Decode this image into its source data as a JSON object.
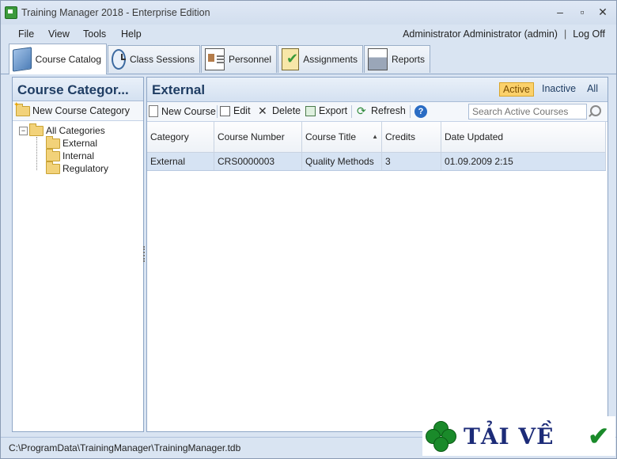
{
  "window": {
    "title": "Training Manager 2018 - Enterprise Edition",
    "minimize": "–",
    "maximize": "▫",
    "close": "✕"
  },
  "menu": {
    "items": [
      "File",
      "View",
      "Tools",
      "Help"
    ]
  },
  "user": {
    "name": "Administrator Administrator (admin)",
    "separator": "|",
    "logoff": "Log Off"
  },
  "tabs": [
    {
      "label": "Course Catalog",
      "icon": "book-icon",
      "active": true
    },
    {
      "label": "Class Sessions",
      "icon": "clock-icon",
      "active": false
    },
    {
      "label": "Personnel",
      "icon": "id-card-icon",
      "active": false
    },
    {
      "label": "Assignments",
      "icon": "clipboard-check-icon",
      "active": false
    },
    {
      "label": "Reports",
      "icon": "printer-icon",
      "active": false
    }
  ],
  "left": {
    "title": "Course Categor...",
    "new_category": "New Course Category",
    "tree": {
      "root": "All Categories",
      "expander": "−",
      "children": [
        "External",
        "Internal",
        "Regulatory"
      ]
    }
  },
  "right": {
    "title": "External",
    "filters": {
      "active": "Active",
      "inactive": "Inactive",
      "all": "All"
    },
    "toolbar": {
      "new": "New Course",
      "edit": "Edit",
      "delete": "Delete",
      "export": "Export",
      "refresh": "Refresh",
      "help": "?"
    },
    "search_placeholder": "Search Active Courses",
    "columns": [
      "Category",
      "Course Number",
      "Course Title",
      "Credits",
      "Date Updated"
    ],
    "sort_indicator": "▲",
    "rows": [
      [
        "External",
        "CRS0000003",
        "Quality Methods",
        "3",
        "01.09.2009 2:15"
      ]
    ]
  },
  "status": {
    "path": "C:\\ProgramData\\TrainingManager\\TrainingManager.tdb"
  },
  "watermark": {
    "text": "TẢI VỀ",
    "check": "✔"
  },
  "colors": {
    "accent": "#1f3d63",
    "selected_row": "#d6e3f3",
    "active_filter": "#fbd16b"
  }
}
